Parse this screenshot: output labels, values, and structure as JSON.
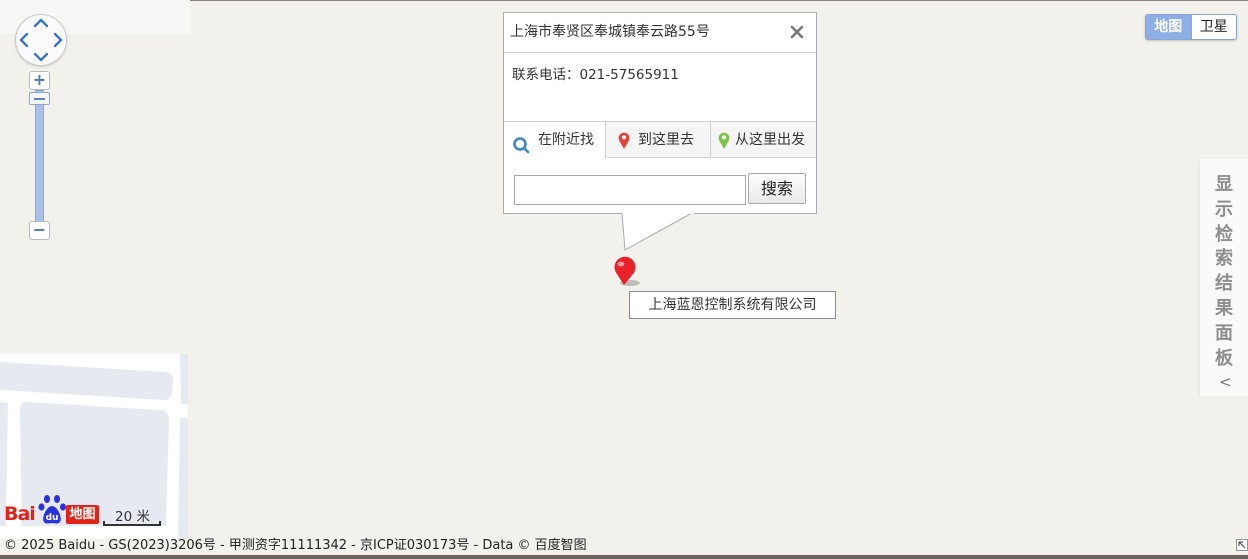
{
  "colors": {
    "map_background": "#f3f1ec",
    "block": "#e6eaf0",
    "road": "#ffffff",
    "maptype_active": "#8eaee6",
    "marker": "#e8212a",
    "logo_red": "#e2231a"
  },
  "icons": {
    "pan": "four-way-arrow-icon",
    "zoom_in": "plus-icon",
    "zoom_out": "minus-icon",
    "close": "close-x-icon",
    "search_nearby": "magnifier-icon",
    "go_here": "red-pin-icon",
    "from_here": "green-pin-icon",
    "marker": "red-map-pin-icon",
    "logo": "baidu-paw-icon"
  },
  "zoom": {
    "in_label": "+",
    "out_label": "−",
    "level_fraction": 0.0
  },
  "map_type": {
    "map_label": "地图",
    "satellite_label": "卫星",
    "active": "地图"
  },
  "panel_toggle": {
    "label": "显示检索结果面板",
    "arrow": "<"
  },
  "info_window": {
    "title": "上海市奉贤区奉城镇奉云路55号",
    "close_label": "✕",
    "phone_label": "联系电话：",
    "phone": "021-57565911",
    "tabs": [
      {
        "label": "在附近找"
      },
      {
        "label": "到这里去"
      },
      {
        "label": "从这里出发"
      }
    ],
    "search_input_value": "",
    "search_button": "搜索"
  },
  "marker": {
    "label": "上海蓝恩控制系统有限公司"
  },
  "logo": {
    "text_bai": "Bai",
    "text_du": "du",
    "text_ditu": "地图"
  },
  "scale": {
    "label": "20 米"
  },
  "copyright": "© 2025 Baidu - GS(2023)3206号 - 甲测资字11111342 - 京ICP证030173号 - Data © 百度智图"
}
